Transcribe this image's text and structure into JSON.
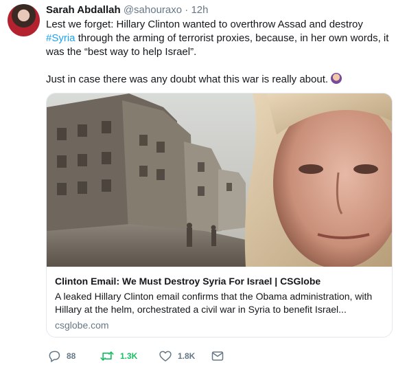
{
  "tweet": {
    "author_name": "Sarah Abdallah",
    "author_handle": "@sahouraxo",
    "separator": "·",
    "time": "12h",
    "text_line1_before": "Lest we forget: Hillary Clinton wanted to overthrow Assad and destroy ",
    "hashtag": "#Syria",
    "text_line1_after": " through the arming of terrorist proxies, because, in her own words, it was the “best way to help Israel”.",
    "text_para2": "Just in case there was any doubt what this war is really about.",
    "emoji_icon": "woman-tipping-hand-icon"
  },
  "card": {
    "title": "Clinton Email: We Must Destroy Syria For Israel | CSGlobe",
    "description": "A leaked Hillary Clinton email confirms that the Obama administration, with Hillary at the helm, orchestrated a civil war in Syria to benefit Israel...",
    "domain": "csglobe.com"
  },
  "actions": {
    "reply_count": "88",
    "retweet_count": "1.3K",
    "like_count": "1.8K",
    "reply_icon": "reply-icon",
    "retweet_icon": "retweet-icon",
    "like_icon": "heart-icon",
    "message_icon": "envelope-icon"
  },
  "colors": {
    "link": "#1da1f2",
    "muted": "#657786",
    "retweet_active": "#17bf63",
    "border": "#e1e8ed"
  }
}
